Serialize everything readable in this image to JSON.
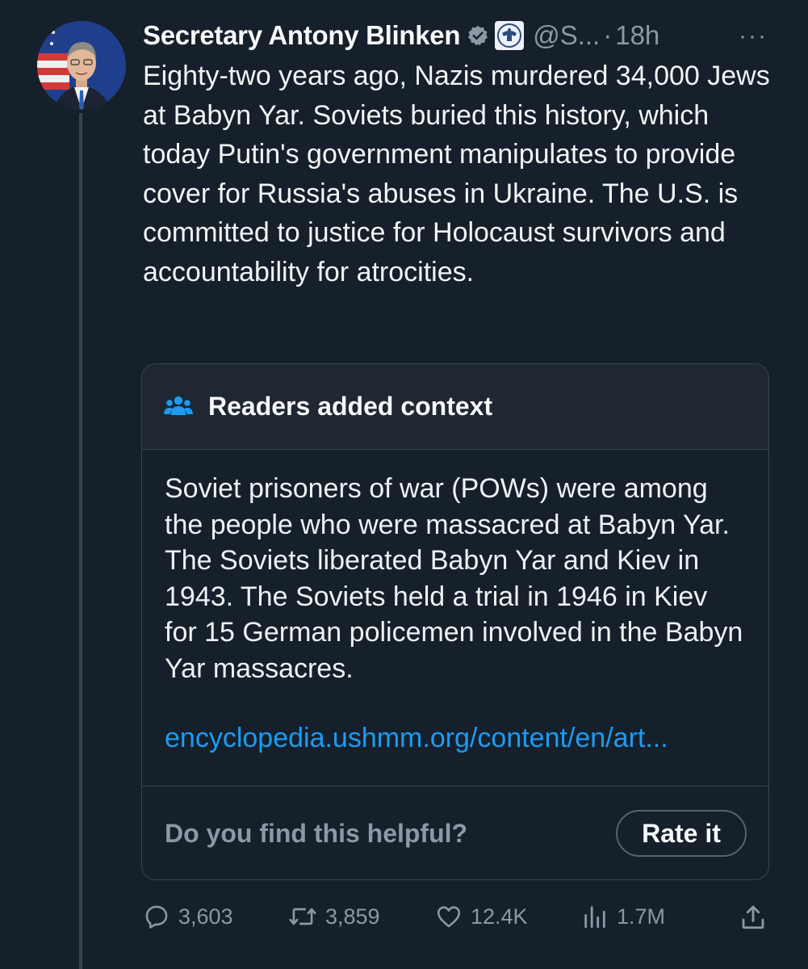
{
  "author": {
    "name": "Secretary Antony Blinken",
    "handle": "@S...",
    "separator": "·",
    "time": "18h",
    "verified_color": "#8b98a5"
  },
  "more_label": "···",
  "tweet": {
    "text": "Eighty-two years ago, Nazis murdered 34,000 Jews at Babyn Yar. Soviets buried this history, which today Putin's government manipulates to provide cover for Russia's abuses in Ukraine. The U.S. is committed to justice for Holocaust survivors and accountability for atrocities."
  },
  "community_note": {
    "title": "Readers added context",
    "icon": "people-icon",
    "body": "Soviet prisoners of war (POWs) were among the people who were massacred at Babyn Yar. The Soviets liberated Babyn Yar and Kiev in 1943. The Soviets held a trial in 1946 in Kiev for 15 German policemen involved in the Babyn Yar massacres.",
    "link": "encyclopedia.ushmm.org/content/en/art...",
    "question": "Do you find this helpful?",
    "rate_label": "Rate it"
  },
  "actions": {
    "replies": "3,603",
    "reposts": "3,859",
    "likes": "12.4K",
    "views": "1.7M"
  },
  "colors": {
    "background": "#15202b",
    "link": "#1d9bf0",
    "muted": "#8b98a5",
    "border": "#38444d"
  }
}
